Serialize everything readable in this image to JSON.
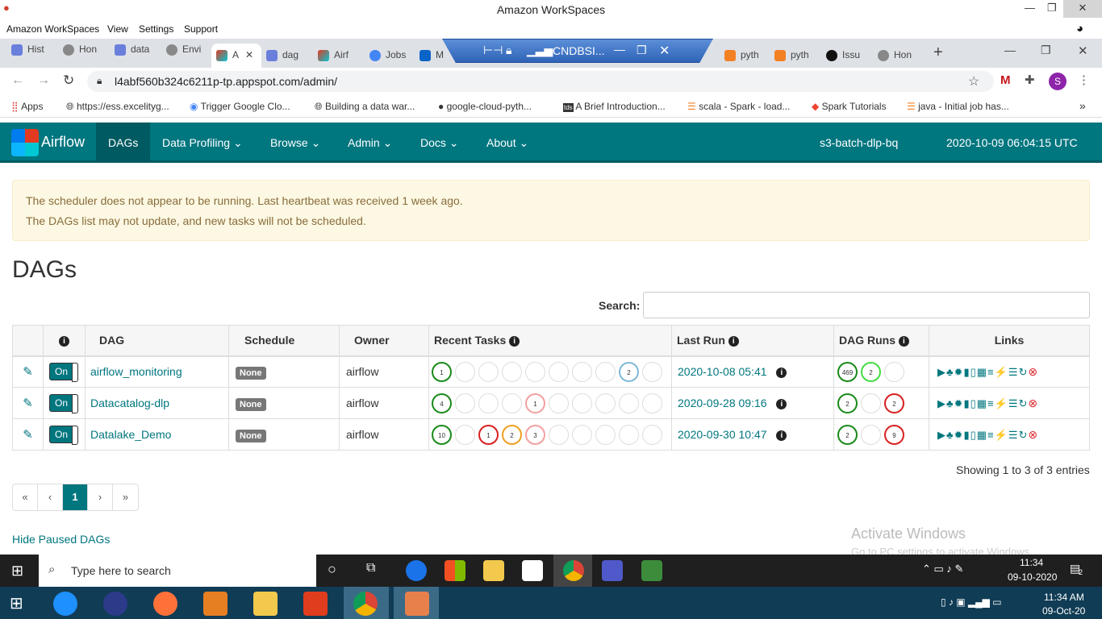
{
  "workspaces": {
    "title": "Amazon WorkSpaces",
    "menu": [
      "Amazon WorkSpaces",
      "View",
      "Settings",
      "Support"
    ]
  },
  "browser": {
    "tabs": [
      "Hist",
      "Hon",
      "data",
      "Envi",
      "A",
      "dag",
      "Airf",
      "Jobs",
      "Ma",
      "pyth",
      "pyth",
      "Issu",
      "Hon"
    ],
    "ws_host": "CNDBSI...",
    "url": "l4abf560b324c6211p-tp.appspot.com/admin/",
    "bookmarks": [
      "Apps",
      "https://ess.excelityg...",
      "Trigger Google Clo...",
      "Building a data war...",
      "google-cloud-pyth...",
      "A Brief Introduction...",
      "scala - Spark - load...",
      "Spark Tutorials",
      "java - Initial job has..."
    ],
    "profile_initial": "S"
  },
  "nav": {
    "brand": "Airflow",
    "items": [
      "DAGs",
      "Data Profiling",
      "Browse",
      "Admin",
      "Docs",
      "About"
    ],
    "env": "s3-batch-dlp-bq",
    "time": "2020-10-09 06:04:15 UTC"
  },
  "alert": {
    "line1": "The scheduler does not appear to be running. Last heartbeat was received 1 week ago.",
    "line2": "The DAGs list may not update, and new tasks will not be scheduled."
  },
  "page": {
    "heading": "DAGs",
    "search_label": "Search:",
    "columns": [
      "DAG",
      "Schedule",
      "Owner",
      "Recent Tasks",
      "Last Run",
      "DAG Runs",
      "Links"
    ],
    "showing": "Showing 1 to 3 of 3 entries",
    "pager": [
      "«",
      "‹",
      "1",
      "›",
      "»"
    ],
    "hide_paused": "Hide Paused DAGs"
  },
  "dags": [
    {
      "toggle": "On",
      "name": "airflow_monitoring",
      "schedule": "None",
      "owner": "airflow",
      "last_run": "2020-10-08 05:41",
      "tasks": [
        [
          "1",
          "#1a8a1a"
        ],
        [
          "",
          ""
        ],
        [
          "",
          ""
        ],
        [
          "",
          ""
        ],
        [
          "",
          ""
        ],
        [
          "",
          ""
        ],
        [
          "",
          ""
        ],
        [
          "",
          ""
        ],
        [
          "2",
          "#7fb9d8"
        ],
        [
          "",
          ""
        ]
      ],
      "runs": [
        [
          "469",
          "#1a8a1a"
        ],
        [
          "2",
          "#44dd44"
        ],
        [
          "",
          ""
        ]
      ]
    },
    {
      "toggle": "On",
      "name": "Datacatalog-dlp",
      "schedule": "None",
      "owner": "airflow",
      "last_run": "2020-09-28 09:16",
      "tasks": [
        [
          "4",
          "#1a8a1a"
        ],
        [
          "",
          ""
        ],
        [
          "",
          ""
        ],
        [
          "",
          ""
        ],
        [
          "1",
          "#f2a0a0"
        ],
        [
          "",
          ""
        ],
        [
          "",
          ""
        ],
        [
          "",
          ""
        ],
        [
          "",
          ""
        ],
        [
          "",
          ""
        ]
      ],
      "runs": [
        [
          "2",
          "#1a8a1a"
        ],
        [
          "",
          ""
        ],
        [
          "2",
          "#d92020"
        ]
      ]
    },
    {
      "toggle": "On",
      "name": "Datalake_Demo",
      "schedule": "None",
      "owner": "airflow",
      "last_run": "2020-09-30 10:47",
      "tasks": [
        [
          "10",
          "#1a8a1a"
        ],
        [
          "",
          ""
        ],
        [
          "1",
          "#d92020"
        ],
        [
          "2",
          "#f0a020"
        ],
        [
          "3",
          "#f2a0a0"
        ],
        [
          "",
          ""
        ],
        [
          "",
          ""
        ],
        [
          "",
          ""
        ],
        [
          "",
          ""
        ],
        [
          "",
          ""
        ]
      ],
      "runs": [
        [
          "2",
          "#1a8a1a"
        ],
        [
          "",
          ""
        ],
        [
          "9",
          "#d92020"
        ]
      ]
    }
  ],
  "windows": {
    "watermark_title": "Activate Windows",
    "watermark_sub": "Go to PC settings to activate Windows.",
    "search_placeholder": "Type here to search",
    "time1": "11:34",
    "date1": "09-10-2020",
    "notif_count": "2",
    "time2": "11:34 AM",
    "date2": "09-Oct-20"
  }
}
